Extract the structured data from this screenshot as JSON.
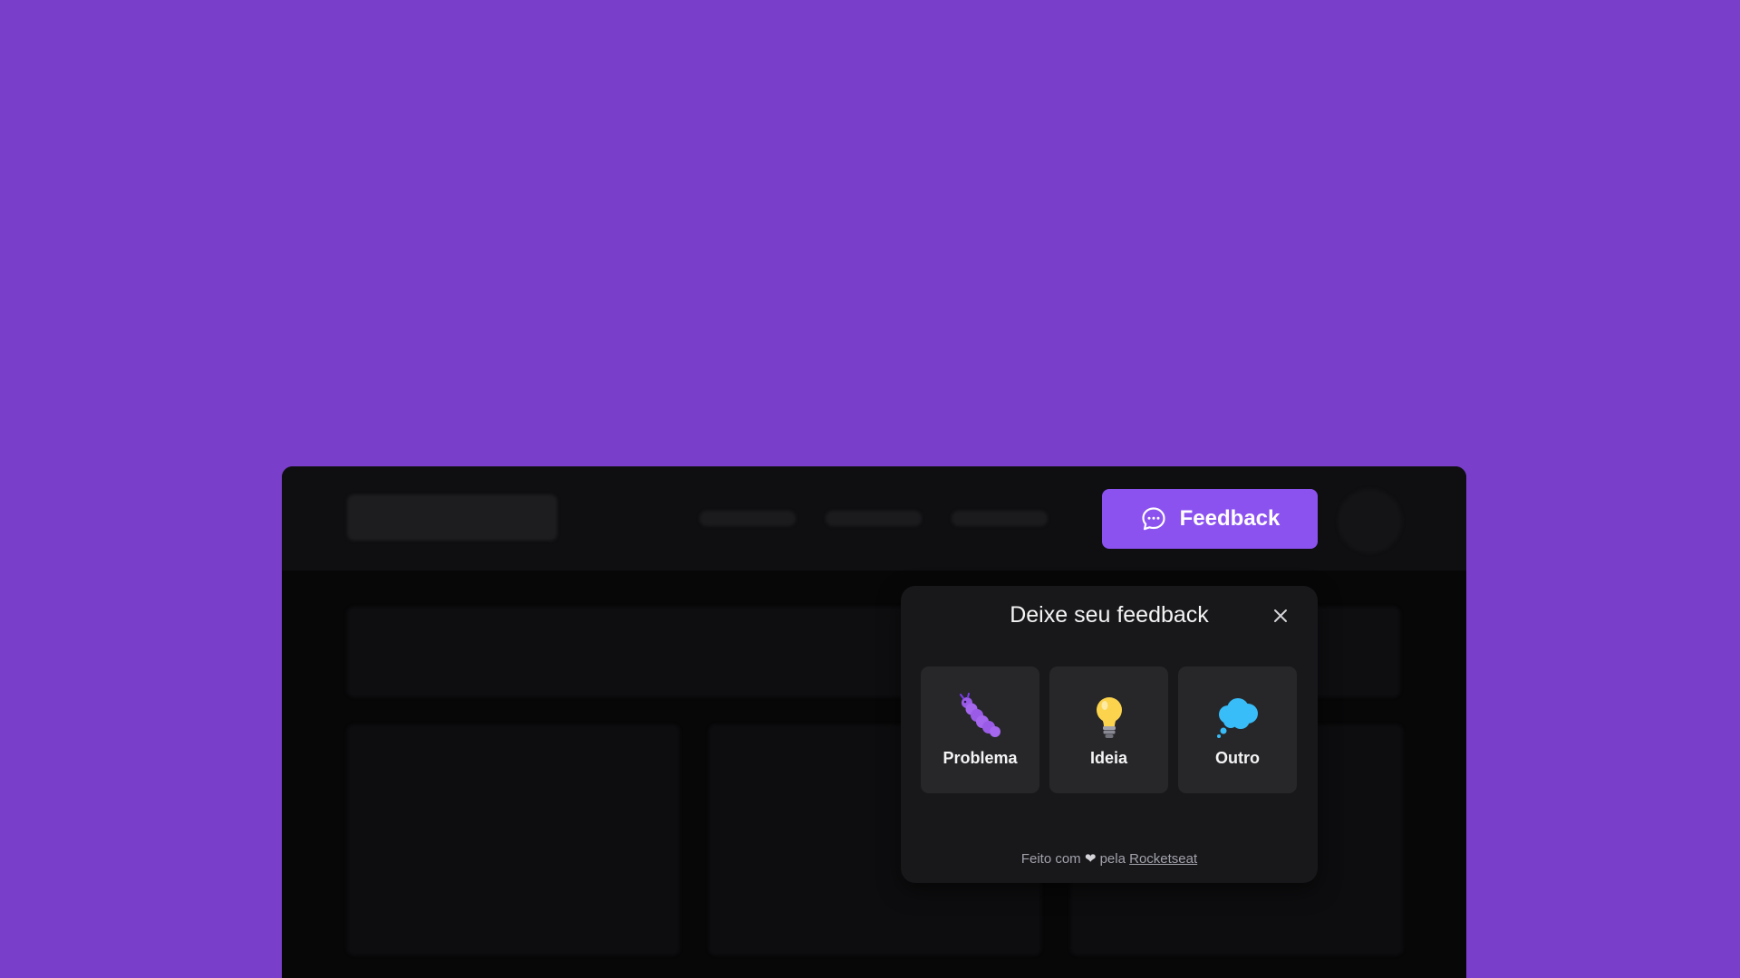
{
  "colors": {
    "background": "#7a3fca",
    "accent": "#8b52f0",
    "surface": "#18181b",
    "option_surface": "#27272a"
  },
  "header": {
    "feedback_button": {
      "label": "Feedback",
      "icon": "chat-bubble-icon"
    }
  },
  "widget": {
    "title": "Deixe seu feedback",
    "close_icon": "close-icon",
    "options": [
      {
        "label": "Problema",
        "icon": "bug-icon"
      },
      {
        "label": "Ideia",
        "icon": "lightbulb-icon"
      },
      {
        "label": "Outro",
        "icon": "thought-cloud-icon"
      }
    ],
    "footer": {
      "prefix": "Feito com",
      "heart": "❤",
      "middle": "pela",
      "link": "Rocketseat"
    }
  }
}
